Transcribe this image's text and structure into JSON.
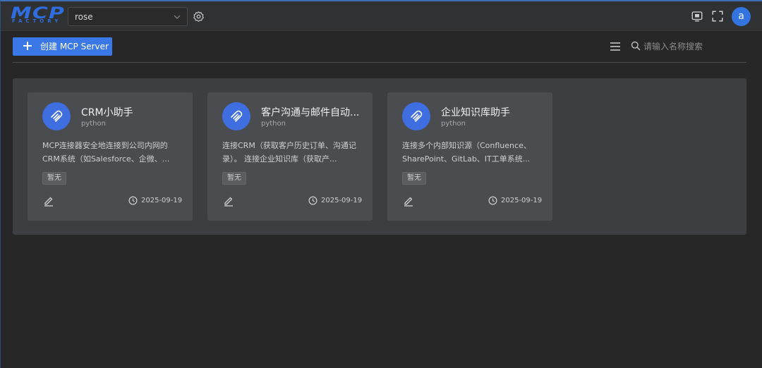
{
  "header": {
    "logo_text": "MCP",
    "logo_sub": "FACTORY",
    "tenant_select": {
      "value": "rose"
    },
    "icons": [
      "settings-icon",
      "screenshot-icon",
      "fullscreen-icon"
    ],
    "avatar_letter": "a"
  },
  "toolbar": {
    "create_label": "创建 MCP Server",
    "search_placeholder": "请输入名称搜索"
  },
  "colors": {
    "accent": "#3a78e7",
    "background": "#272727",
    "panel": "#3c3e41",
    "card": "#4a4c50"
  },
  "cards": [
    {
      "title": "CRM小助手",
      "lang": "python",
      "desc": "MCP连接器安全地连接到公司内网的CRM系统（如Salesforce、企微、...",
      "tag": "暂无",
      "date": "2025-09-19"
    },
    {
      "title": "客户沟通与邮件自动...",
      "lang": "python",
      "desc": "连接CRM（获取客户历史订单、沟通记录）。 连接企业知识库（获取产...",
      "tag": "暂无",
      "date": "2025-09-19"
    },
    {
      "title": "企业知识库助手",
      "lang": "python",
      "desc": "连接多个内部知识源（Confluence、SharePoint、GitLab、IT工单系统...",
      "tag": "暂无",
      "date": "2025-09-19"
    }
  ]
}
